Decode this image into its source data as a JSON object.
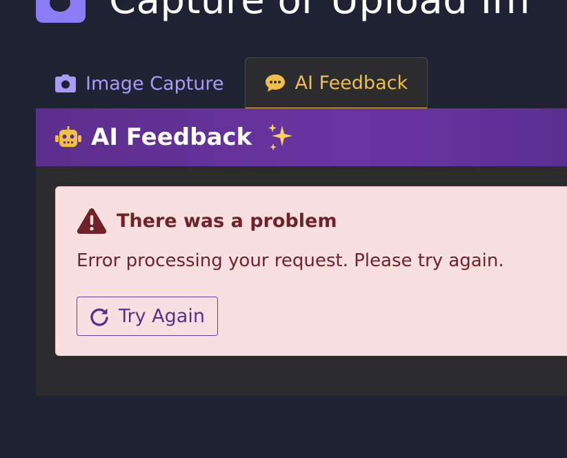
{
  "app": {
    "title": "Capture or Upload Im",
    "logo_icon": "camera-logo-icon"
  },
  "tabs": [
    {
      "label": "Image Capture",
      "icon": "camera-icon",
      "active": false
    },
    {
      "label": "AI Feedback",
      "icon": "speech-bubble-icon",
      "active": true
    }
  ],
  "feedback": {
    "title": "AI Feedback",
    "title_icon": "robot-icon",
    "decor_icon": "sparkles-icon"
  },
  "alert": {
    "icon": "warning-triangle-icon",
    "title": "There was a problem",
    "message": "Error processing your request. Please try again.",
    "retry_label": "Try Again",
    "retry_icon": "refresh-icon"
  },
  "colors": {
    "background": "#1f2233",
    "accent_purple": "#8b7cf6",
    "active_tab": "#f0bf4a",
    "header_gradient": "#5b2e8c",
    "alert_bg": "#f8e0e1",
    "alert_text": "#6f2228"
  }
}
